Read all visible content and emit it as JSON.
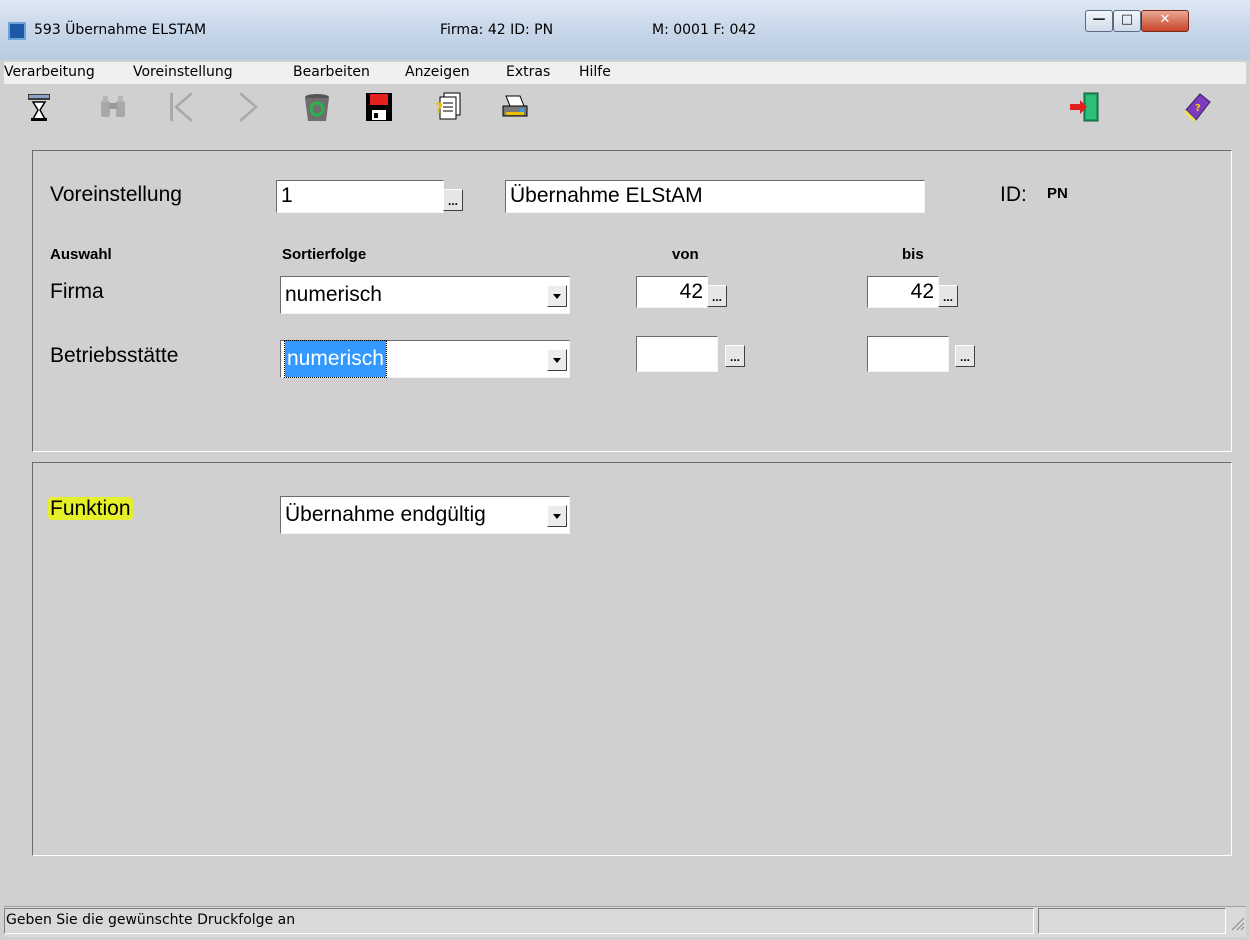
{
  "window": {
    "title": "593 Übernahme ELSTAM",
    "firma_info": "Firma:  42  ID: PN",
    "m_info": "M: 0001 F: 042"
  },
  "menu": [
    "Verarbeitung",
    "Voreinstellung",
    "Bearbeiten",
    "Anzeigen",
    "Extras",
    "Hilfe"
  ],
  "toolbar": {
    "icons": [
      "hourglass-icon",
      "binoculars-icon",
      "previous-icon",
      "next-icon",
      "recycle-icon",
      "save-icon",
      "documents-icon",
      "print-icon",
      "exit-icon",
      "help-book-icon"
    ]
  },
  "form": {
    "voreinstellung_label": "Voreinstellung",
    "voreinstellung_value": "1",
    "voreinstellung_name": "Übernahme ELStAM",
    "id_label": "ID:",
    "id_value": "PN",
    "header_auswahl": "Auswahl",
    "header_sortierfolge": "Sortierfolge",
    "header_von": "von",
    "header_bis": "bis",
    "firma_label": "Firma",
    "firma_sort": "numerisch",
    "firma_von": "42",
    "firma_bis": "42",
    "betrieb_label": "Betriebsstätte",
    "betrieb_sort": "numerisch",
    "betrieb_von": "",
    "betrieb_bis": "",
    "dots": "...",
    "funktion_label": "Funktion",
    "funktion_value": "Übernahme endgültig"
  },
  "status": {
    "text": "Geben Sie die gewünschte Druckfolge an"
  },
  "colors": {
    "highlight": "#e6f02a",
    "selection": "#3399ff"
  }
}
